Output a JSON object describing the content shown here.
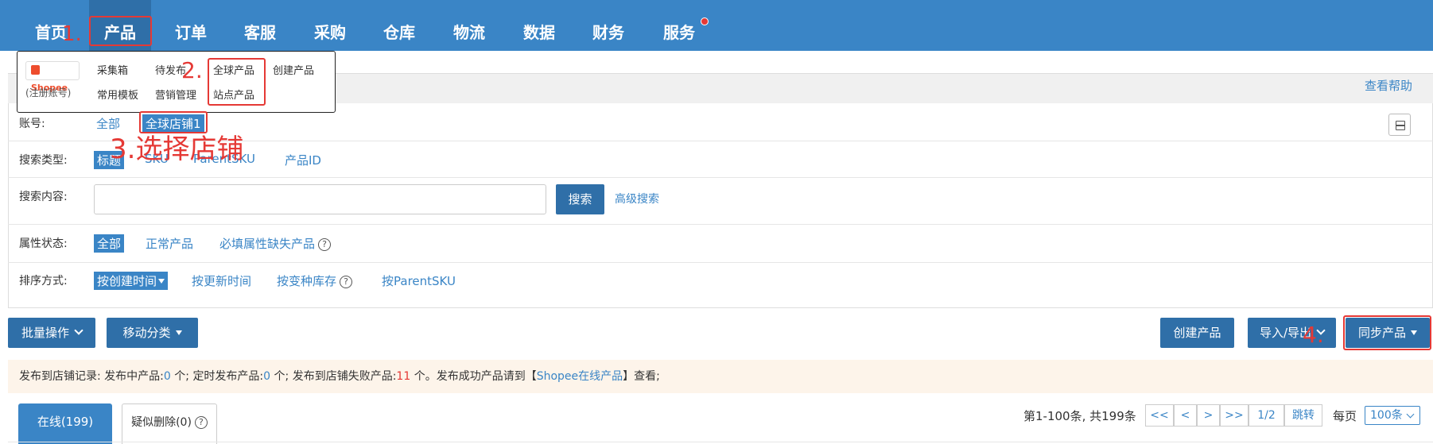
{
  "nav": {
    "items": [
      {
        "label": "首页"
      },
      {
        "label": "产品"
      },
      {
        "label": "订单"
      },
      {
        "label": "客服"
      },
      {
        "label": "采购"
      },
      {
        "label": "仓库"
      },
      {
        "label": "物流"
      },
      {
        "label": "数据"
      },
      {
        "label": "财务"
      },
      {
        "label": "服务"
      }
    ],
    "active": "产品"
  },
  "dropdown": {
    "logo_text": "Shopee",
    "register_account": "(注册账号)",
    "collect_box": "采集箱",
    "pending_publish": "待发布",
    "global_products": "全球产品",
    "create_product": "创建产品",
    "common_templates": "常用模板",
    "marketing": "营销管理",
    "site_products": "站点产品"
  },
  "help": {
    "link": "查看帮助"
  },
  "filters": {
    "account": {
      "label": "账号:",
      "options": [
        "全部",
        "全球店铺1"
      ],
      "selected": "全球店铺1"
    },
    "search_type": {
      "label": "搜索类型:",
      "options": [
        "标题",
        "SKU",
        "ParentSKU",
        "产品ID"
      ],
      "selected": "标题"
    },
    "search_content": {
      "label": "搜索内容:",
      "value": "",
      "placeholder": "",
      "search_button": "搜索",
      "advanced": "高级搜索"
    },
    "attr_status": {
      "label": "属性状态:",
      "options": [
        "全部",
        "正常产品",
        "必填属性缺失产品"
      ],
      "selected": "全部"
    },
    "sort": {
      "label": "排序方式:",
      "options": [
        "按创建时间",
        "按更新时间",
        "按变种库存",
        "按ParentSKU"
      ],
      "selected": "按创建时间"
    }
  },
  "actions": {
    "batch": "批量操作",
    "move_category": "移动分类",
    "create_product": "创建产品",
    "import_export": "导入/导出",
    "sync_products": "同步产品"
  },
  "info": {
    "prefix": "发布到店铺记录:",
    "publishing_label": "发布中产品:",
    "publishing_count": "0",
    "unit": "个;",
    "scheduled_label": "定时发布产品:",
    "scheduled_count": "0",
    "failed_label": "发布到店铺失败产品:",
    "failed_count": "11",
    "failed_unit": "个。",
    "success_text": "发布成功产品请到【",
    "shopee_online": "Shopee在线产品",
    "suffix": "】查看;"
  },
  "tabs": {
    "online": "在线(199)",
    "suspected_deleted": "疑似删除(0)"
  },
  "pagination": {
    "summary": "第1-100条, 共199条",
    "first": "<<",
    "prev": "<",
    "next": ">",
    "last": ">>",
    "page": "1/2",
    "jump": "跳转",
    "per_page_label": "每页",
    "per_page_value": "100条"
  },
  "annotations": {
    "step1": "1.",
    "step2": "2.",
    "step3": "3.选择店铺",
    "step4": "4."
  },
  "colors": {
    "primary": "#3a85c6",
    "primary_dark": "#2f6fa8",
    "annotation_red": "#e53935",
    "info_bg": "#fdf4ea"
  }
}
